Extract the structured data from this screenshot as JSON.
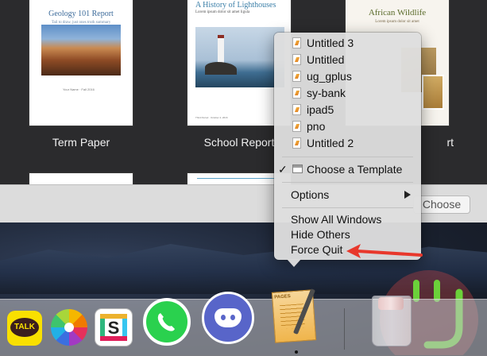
{
  "chooser": {
    "templates": [
      {
        "label": "Term Paper",
        "title": "Geology 101 Report",
        "subtitle": "Tail to draw, just ones truth summary",
        "foot": "Your Name · Fall 2016"
      },
      {
        "label": "School Report",
        "title": "A History of Lighthouses",
        "subtitle": "Lorem ipsum dolor sit amet ligula",
        "foot": "Third Period · October 4, 2016"
      },
      {
        "label": "rt",
        "title": "African Wildlife",
        "subtitle": "Lorem ipsum dolor sit amet"
      }
    ],
    "choose_button": "Choose"
  },
  "menu": {
    "recent_documents": [
      "Untitled 3",
      "Untitled",
      "ug_gplus",
      "sy-bank",
      "ipad5",
      "pno",
      "Untitled 2"
    ],
    "choose_template": "Choose a Template",
    "choose_template_checkmark": "✓",
    "options": "Options",
    "show_all_windows": "Show All Windows",
    "hide_others": "Hide Others",
    "force_quit": "Force Quit"
  },
  "dock": {
    "apps": [
      "KakaoTalk",
      "Photos",
      "Slack",
      "WhatsApp",
      "Discord",
      "Pages",
      "Trash"
    ],
    "kakao_text": "TALK",
    "pages_text": "PAGES"
  },
  "colors": {
    "annotation_arrow": "#e8382c",
    "menu_background": "#dedede"
  }
}
